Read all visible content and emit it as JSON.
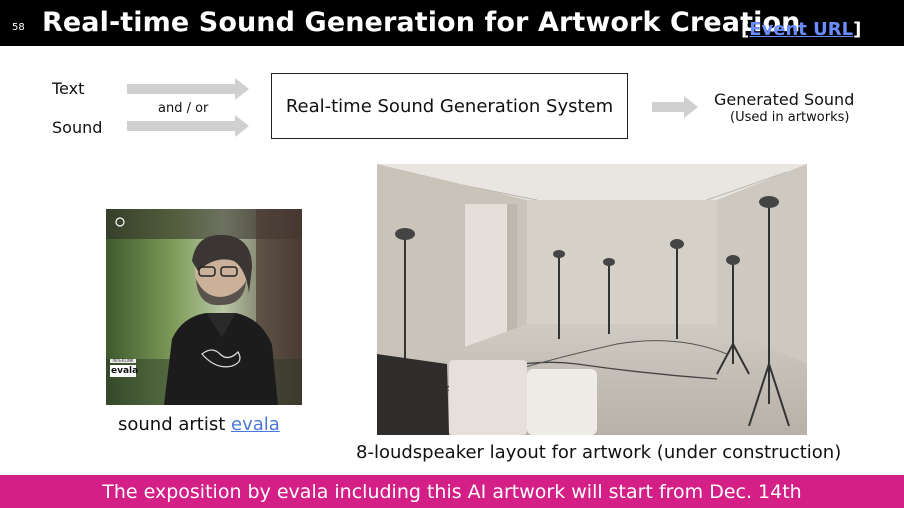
{
  "slide": {
    "number": "58",
    "title": "Real-time Sound Generation for Artwork Creation",
    "link_open": "[",
    "link_text": "Event URL",
    "link_close": "]"
  },
  "diagram": {
    "input_text": "Text",
    "input_sound": "Sound",
    "connector": "and / or",
    "system": "Real-time Sound Generation System",
    "output": "Generated Sound",
    "output_note": "(Used in artworks)"
  },
  "portrait": {
    "caption_prefix": "sound artist ",
    "caption_link": "evala",
    "badge_small": "INTERLINK",
    "badge_name": "evala"
  },
  "room_photo": {
    "caption": "8-loudspeaker layout for artwork (under construction)"
  },
  "footer": {
    "text": "The exposition by evala including this AI artwork will start from Dec. 14th"
  },
  "colors": {
    "header_bg": "#000000",
    "footer_bg": "#d41f87",
    "link": "#4a78d8",
    "arrow": "#d0d0d0"
  }
}
